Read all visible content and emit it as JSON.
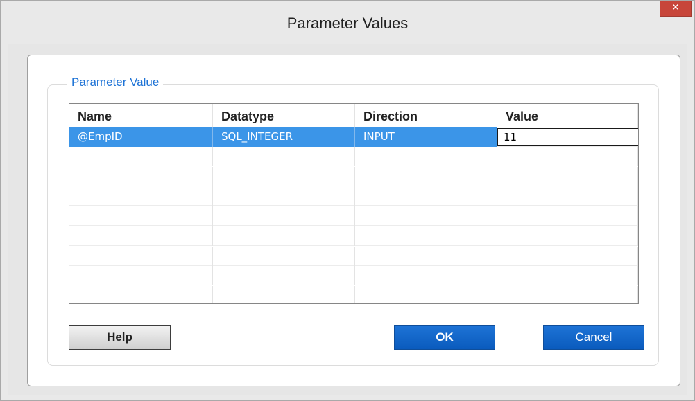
{
  "window": {
    "title": "Parameter Values",
    "close_icon": "close-icon",
    "close_glyph": "✕"
  },
  "group": {
    "legend": "Parameter Value"
  },
  "grid": {
    "columns": [
      "Name",
      "Datatype",
      "Direction",
      "Value"
    ],
    "rows": [
      {
        "name": "@EmpID",
        "datatype": "SQL_INTEGER",
        "direction": "INPUT",
        "value": "11",
        "selected": true
      }
    ],
    "empty_rows": 8
  },
  "buttons": {
    "help": "Help",
    "ok": "OK",
    "cancel": "Cancel"
  },
  "colors": {
    "accent": "#1e73d6",
    "selection": "#3b95e8",
    "close": "#c7463a"
  }
}
